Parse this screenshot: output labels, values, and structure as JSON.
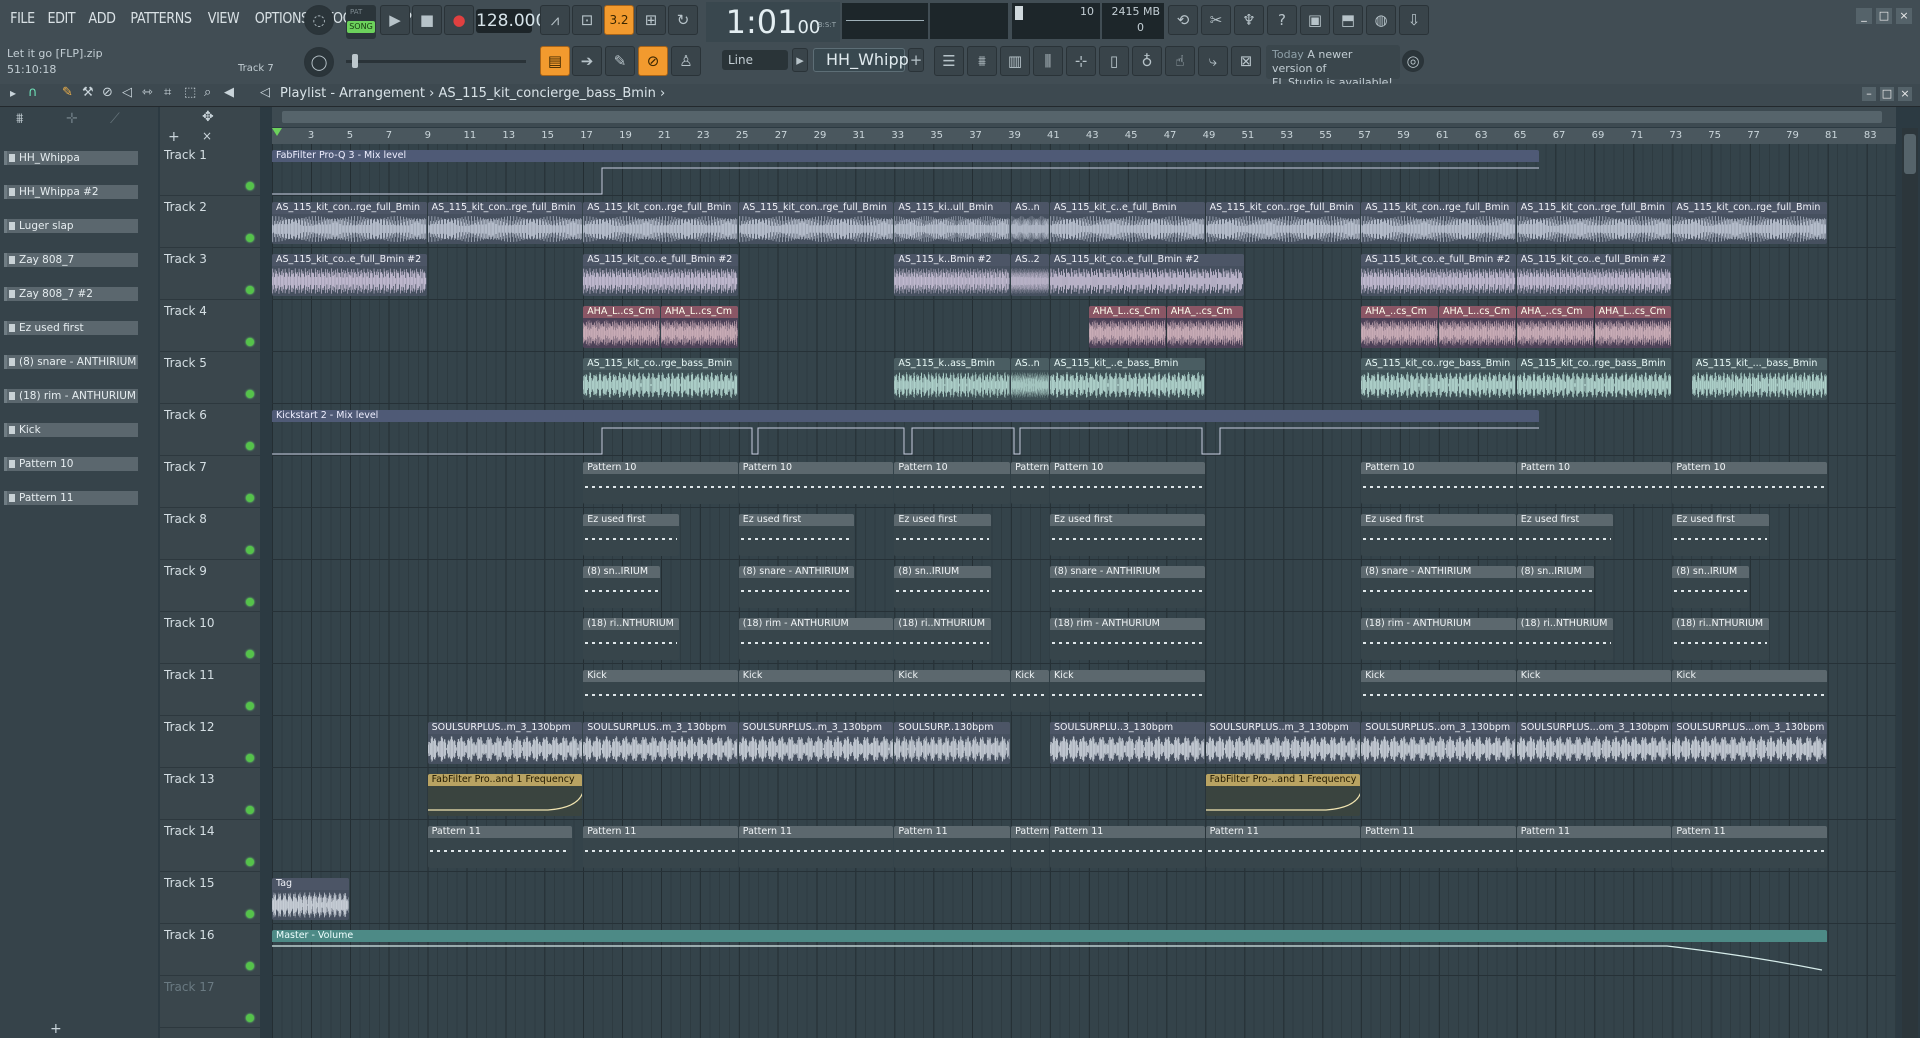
{
  "menu": [
    "FILE",
    "EDIT",
    "ADD",
    "PATTERNS",
    "VIEW",
    "OPTIONS",
    "TOOLS",
    "HELP"
  ],
  "project": {
    "file": "Let it go [FLP].zip",
    "time": "51:10:18",
    "hint_track": "Track 7"
  },
  "transport": {
    "mode": "SONG",
    "tempo": "128.000",
    "time": "1:01",
    "time_sub": "00",
    "time_label": "B:S:T",
    "time_sig": "3.2",
    "pat_label": "PAT"
  },
  "monitor": {
    "cpu": "10",
    "ram": "2415 MB",
    "poly": "0"
  },
  "snap": {
    "label": "Line"
  },
  "pattern_selector": {
    "value": "HH_Whippa"
  },
  "news": {
    "line1": "Today",
    "line2": "A newer version of",
    "line3": "FL Studio is available!"
  },
  "playlist": {
    "title": "Playlist - Arrangement",
    "separator": "›",
    "pattern": "AS_115_kit_concierge_bass_Bmin"
  },
  "picker": [
    "HH_Whippa",
    "HH_Whippa #2",
    "Luger slap",
    "Zay 808_7",
    "Zay 808_7 #2",
    "Ez used first",
    "(8) snare - ANTHIRIUM",
    "(18) rim - ANTHURIUM",
    "Kick",
    "Pattern 10",
    "Pattern 11"
  ],
  "ruler": [
    "3",
    "5",
    "7",
    "9",
    "11",
    "13",
    "15",
    "17",
    "19",
    "21",
    "23",
    "25",
    "27",
    "29",
    "31",
    "33",
    "35",
    "37",
    "39",
    "41",
    "43",
    "45",
    "47",
    "49",
    "51",
    "53",
    "55",
    "57",
    "59",
    "61",
    "63",
    "65",
    "67",
    "69",
    "71",
    "73",
    "75",
    "77",
    "79",
    "81",
    "83"
  ],
  "tracks": [
    "Track 1",
    "Track 2",
    "Track 3",
    "Track 4",
    "Track 5",
    "Track 6",
    "Track 7",
    "Track 8",
    "Track 9",
    "Track 10",
    "Track 11",
    "Track 12",
    "Track 13",
    "Track 14",
    "Track 15",
    "Track 16",
    "Track 17"
  ],
  "clip_labels": {
    "t1": "FabFilter Pro-Q 3 - Mix level",
    "t2": [
      "AS_115_kit_con..rge_full_Bmin",
      "AS_115_kit_con..rge_full_Bmin",
      "AS_115_kit_con..rge_full_Bmin",
      "AS_115_kit_con..rge_full_Bmin",
      "AS_115_ki..ull_Bmin",
      "AS..n",
      "AS_115_kit_c..e_full_Bmin",
      "AS_115_kit_con..rge_full_Bmin",
      "AS_115_kit_con..rge_full_Bmin",
      "AS_115_kit_con..rge_full_Bmin",
      "AS_115_kit_con..rge_full_Bmin"
    ],
    "t3": [
      "AS_115_kit_co..e_full_Bmin #2",
      "AS_115_kit_co..e_full_Bmin #2",
      "AS_115_k..Bmin #2",
      "AS..2",
      "AS_115_kit_co..e_full_Bmin #2",
      "AS_115_kit_co..e_full_Bmin #2",
      "AS_115_kit_co..e_full_Bmin #2"
    ],
    "t4": [
      "AHA_L..cs_Cm",
      "AHA_L..cs_Cm",
      "AHA_L..cs_Cm",
      "AHA_..cs_Cm",
      "AHA_..cs_Cm",
      "AHA_L..cs_Cm",
      "AHA_..cs_Cm",
      "AHA_L..cs_Cm"
    ],
    "t5": [
      "AS_115_kit_co..rge_bass_Bmin",
      "AS_115_k..ass_Bmin",
      "AS..n",
      "AS_115_kit_..e_bass_Bmin",
      "AS_115_kit_co..rge_bass_Bmin",
      "AS_115_kit_co..rge_bass_Bmin",
      "AS_115_kit_..._bass_Bmin"
    ],
    "t6": "Kickstart 2 - Mix level",
    "t7": "Pattern 10",
    "t8": "Ez used first",
    "t9": [
      "(8) sn..IRIUM",
      "(8) snare - ANTHIRIUM"
    ],
    "t10": [
      "(18) ri..NTHURIUM",
      "(18) rim - ANTHURIUM"
    ],
    "t11": "Kick",
    "t12": [
      "SOULSURPLUS..m_3_130bpm",
      "SOULSURP..130bpm",
      "SOULSURPLU..3_130bpm",
      "SOULSURPLUS..om_3_130bpm",
      "SOULSURPLUS...om_3_130bpm"
    ],
    "t13": [
      "FabFilter Pro..and 1 Frequency",
      "FabFilter Pro-..and 1 Frequency"
    ],
    "t14": "Pattern 11",
    "t15": "Tag",
    "t16": "Master - Volume"
  },
  "colors": {
    "accent": "#f29a2e",
    "background": "#34434a",
    "toolbar": "#414d54"
  }
}
